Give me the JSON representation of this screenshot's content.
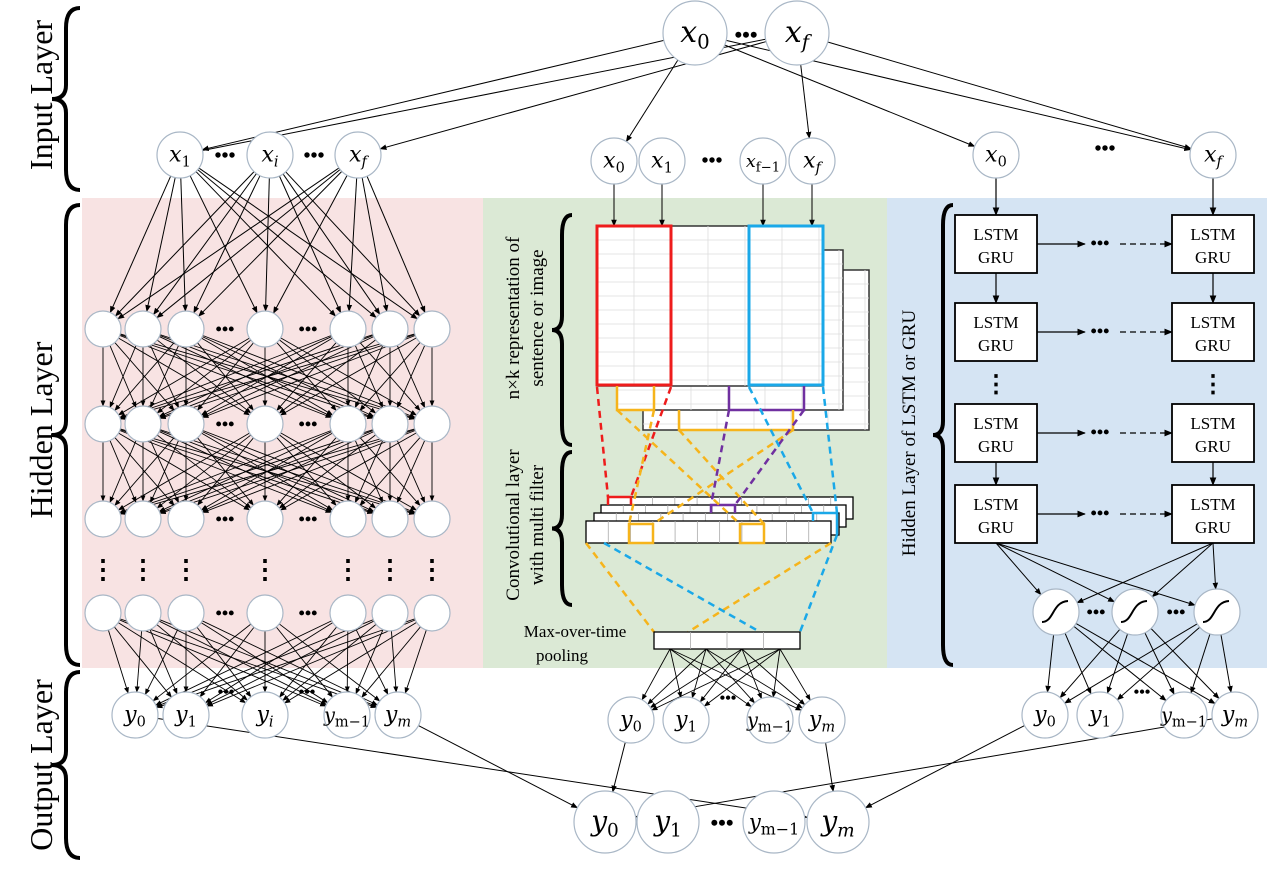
{
  "layers": {
    "input": "Input Layer",
    "hidden": "Hidden Layer",
    "output": "Output Layer"
  },
  "colors": {
    "dnn_panel": "#f8e3e3",
    "cnn_panel": "#dbe9d5",
    "rnn_panel": "#d5e4f3",
    "filter_red": "#ee1c1c",
    "filter_blue": "#1aa8e8",
    "filter_yellow": "#f6b41b",
    "filter_purple": "#7030a0",
    "node_stroke": "#a9b7c6"
  },
  "global_input": {
    "nodes": [
      {
        "base": "x",
        "sub": "0"
      },
      {
        "base": "x",
        "sub": "f"
      }
    ],
    "ellipsis": "•••"
  },
  "dnn": {
    "inputs": [
      {
        "base": "x",
        "sub": "1"
      },
      {
        "base": "x",
        "sub": "i"
      },
      {
        "base": "x",
        "sub": "f"
      }
    ],
    "outputs": [
      {
        "base": "y",
        "sub": "0"
      },
      {
        "base": "y",
        "sub": "1"
      },
      {
        "base": "y",
        "sub": "i"
      },
      {
        "base": "y",
        "sub": "m−1"
      },
      {
        "base": "y",
        "sub": "m"
      }
    ],
    "ellipsis": "•••",
    "vdots": "⋮"
  },
  "cnn": {
    "inputs": [
      {
        "base": "x",
        "sub": "0"
      },
      {
        "base": "x",
        "sub": "1"
      },
      {
        "base": "x",
        "sub": "f−1"
      },
      {
        "base": "x",
        "sub": "f"
      }
    ],
    "outputs": [
      {
        "base": "y",
        "sub": "0"
      },
      {
        "base": "y",
        "sub": "1"
      },
      {
        "base": "y",
        "sub": "m−1"
      },
      {
        "base": "y",
        "sub": "m"
      }
    ],
    "repr_label_1": "n×k representation of",
    "repr_label_2": "sentence or image",
    "conv_label_1": "Convolutional layer",
    "conv_label_2": "with multi filter",
    "pool_label_1": "Max-over-time",
    "pool_label_2": "pooling",
    "ellipsis": "•••"
  },
  "rnn": {
    "inputs": [
      {
        "base": "x",
        "sub": "0"
      },
      {
        "base": "x",
        "sub": "f"
      }
    ],
    "cell_line1": "LSTM",
    "cell_line2": "GRU",
    "hidden_label": "Hidden Layer of LSTM or GRU",
    "outputs": [
      {
        "base": "y",
        "sub": "0"
      },
      {
        "base": "y",
        "sub": "1"
      },
      {
        "base": "y",
        "sub": "m−1"
      },
      {
        "base": "y",
        "sub": "m"
      }
    ],
    "ellipsis": "•••",
    "vdots": "⋮"
  },
  "final_output": {
    "nodes": [
      {
        "base": "y",
        "sub": "0"
      },
      {
        "base": "y",
        "sub": "1"
      },
      {
        "base": "y",
        "sub": "m−1"
      },
      {
        "base": "y",
        "sub": "m"
      }
    ],
    "ellipsis": "•••"
  }
}
